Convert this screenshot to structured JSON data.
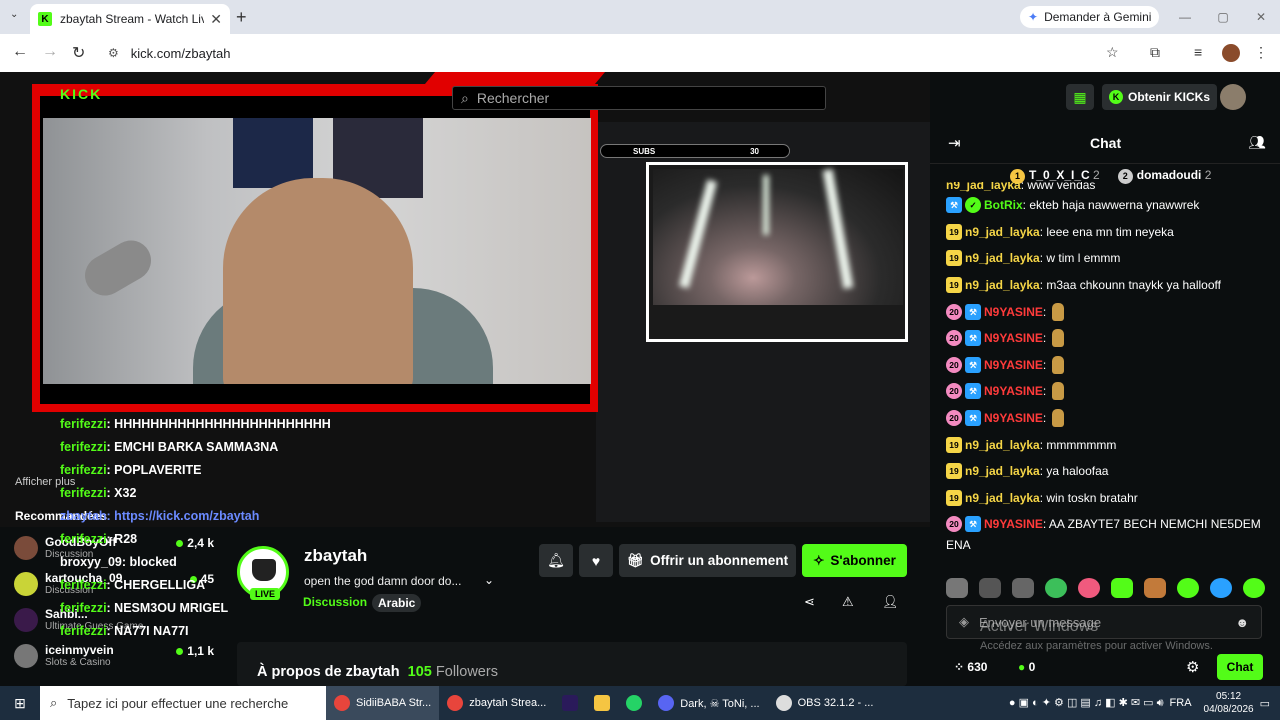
{
  "browser": {
    "tab_title": "zbaytah Stream - Watch Live o",
    "gemini_label": "Demander à Gemini",
    "url": "kick.com/zbaytah"
  },
  "site": {
    "logo": "KICK",
    "search_placeholder": "Rechercher",
    "kicks_label": "Obtenir KICKs"
  },
  "stream_overlay": {
    "subs_label": "SUBS",
    "subs_count": "30",
    "chat_lines": [
      {
        "user": "ferifezzi",
        "text": ": HHHHHHHHHHHHHHHHHHHHHHHH"
      },
      {
        "user": "ferifezzi",
        "text": ": EMCHI BARKA SAMMA3NA"
      },
      {
        "user": "ferifezzi",
        "text": ": POPLAVERITE"
      },
      {
        "user": "ferifezzi",
        "text": ": X32"
      },
      {
        "user": "zbaytah",
        "text": ": https://kick.com/zbaytah"
      },
      {
        "user": "ferifezzi",
        "text": ": R28"
      },
      {
        "user": "broxyy_09",
        "text": ": blocked"
      },
      {
        "user": "ferifezzi",
        "text": ": CHERGELLIGA"
      },
      {
        "user": "ferifezzi",
        "text": ": NESM3OU MRIGEL"
      },
      {
        "user": "ferifezzi",
        "text": ": NA77I NA77I"
      }
    ]
  },
  "sidebar": {
    "show_more": "Afficher plus",
    "recommended_title": "Recommandées",
    "recommended": [
      {
        "name": "GoodBoyOff",
        "category": "Discussion",
        "viewers": "2,4 k"
      },
      {
        "name": "kartoucha_09",
        "category": "Discussion",
        "viewers": "45"
      },
      {
        "name": "Sahbi...",
        "category": "Ultimate Guess Game",
        "viewers": ""
      },
      {
        "name": "iceinmyvein",
        "category": "Slots & Casino",
        "viewers": "1,1 k"
      }
    ]
  },
  "stream_info": {
    "username": "zbaytah",
    "live_label": "LIVE",
    "title": "open the god damn door do...",
    "category": "Discussion",
    "tag": "Arabic",
    "gift_label": "Offrir un abonnement",
    "subscribe_label": "S'abonner",
    "about_prefix": "À propos de zbaytah",
    "followers_count": "105",
    "followers_label": "Followers"
  },
  "chat": {
    "title": "Chat",
    "leaders": [
      {
        "name": "T_0_X_I_C",
        "count": "2",
        "color": "#f5c542"
      },
      {
        "name": "domadoudi",
        "count": "2",
        "color": "#cccccc"
      }
    ],
    "messages": [
      {
        "badge": "",
        "badge2": "",
        "user": "n9_jad_layka",
        "user_color": "#f5d547",
        "text": ": www vendas"
      },
      {
        "badge": "bot",
        "badge2": "verified",
        "user": "BotRix",
        "user_color": "#53fc18",
        "text": ": ekteb haja nawwerna ynawwrek"
      },
      {
        "badge": "19",
        "badge2": "",
        "user": "n9_jad_layka",
        "user_color": "#f5d547",
        "text": ": leee ena mn tim neyeka"
      },
      {
        "badge": "19",
        "badge2": "",
        "user": "n9_jad_layka",
        "user_color": "#f5d547",
        "text": ": w tim l emmm"
      },
      {
        "badge": "19",
        "badge2": "",
        "user": "n9_jad_layka",
        "user_color": "#f5d547",
        "text": ": m3aa chkounn tnaykk ya hallooff"
      },
      {
        "badge": "20",
        "badge2": "bot",
        "user": "N9YASINE",
        "user_color": "#ff3b3b",
        "text": ":"
      },
      {
        "badge": "20",
        "badge2": "bot",
        "user": "N9YASINE",
        "user_color": "#ff3b3b",
        "text": ":"
      },
      {
        "badge": "20",
        "badge2": "bot",
        "user": "N9YASINE",
        "user_color": "#ff3b3b",
        "text": ":"
      },
      {
        "badge": "20",
        "badge2": "bot",
        "user": "N9YASINE",
        "user_color": "#ff3b3b",
        "text": ":"
      },
      {
        "badge": "20",
        "badge2": "bot",
        "user": "N9YASINE",
        "user_color": "#ff3b3b",
        "text": ":"
      },
      {
        "badge": "19",
        "badge2": "",
        "user": "n9_jad_layka",
        "user_color": "#f5d547",
        "text": ": mmmmmmm"
      },
      {
        "badge": "19",
        "badge2": "",
        "user": "n9_jad_layka",
        "user_color": "#f5d547",
        "text": ": ya haloofaa"
      },
      {
        "badge": "19",
        "badge2": "",
        "user": "n9_jad_layka",
        "user_color": "#f5d547",
        "text": ": win toskn bratahr"
      },
      {
        "badge": "20",
        "badge2": "bot",
        "user": "N9YASINE",
        "user_color": "#ff3b3b",
        "text": ": AA ZBAYTE7 BECH NEMCHI NE5DEM"
      }
    ],
    "last_wrap": "ENA",
    "input_placeholder": "Envoyer un message",
    "points": "630",
    "kicks": "0",
    "send_label": "Chat",
    "activate_title": "Activer Windows",
    "activate_sub": "Accédez aux paramètres pour activer Windows."
  },
  "taskbar": {
    "search_placeholder": "Tapez ici pour effectuer une recherche",
    "apps": [
      {
        "label": "SidiiBABA Str...",
        "color": "#e8453c",
        "active": true
      },
      {
        "label": "zbaytah Strea...",
        "color": "#e8453c",
        "active": false
      },
      {
        "label": "",
        "color": "#9999ff",
        "active": false
      },
      {
        "label": "",
        "color": "#f5c542",
        "active": false
      },
      {
        "label": "",
        "color": "#25d366",
        "active": false
      },
      {
        "label": "Dark, ☠ ToNi, ...",
        "color": "#5865f2",
        "active": false
      },
      {
        "label": "OBS 32.1.2 - ...",
        "color": "#dddddd",
        "active": false
      }
    ],
    "lang": "FRA",
    "time": "05:12",
    "date": "04/08/2026"
  }
}
